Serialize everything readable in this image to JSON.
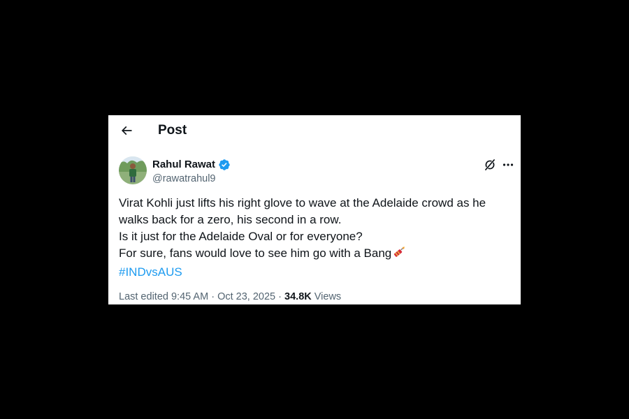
{
  "header": {
    "title": "Post"
  },
  "author": {
    "display_name": "Rahul Rawat",
    "handle": "@rawatrahul9",
    "verified": true
  },
  "tweet": {
    "lines": [
      "Virat Kohli just lifts his right glove to wave at the Adelaide crowd as he",
      "walks back for a zero, his second in a row.",
      "Is it just for the Adelaide Oval or for everyone?",
      "For sure, fans would love to see him go with a Bang"
    ],
    "hashtag": "#INDvsAUS"
  },
  "meta": {
    "edited_label": "Last edited",
    "time": "9:45 AM",
    "separator": "·",
    "date": "Oct 23, 2025",
    "views_count": "34.8K",
    "views_label": "Views"
  },
  "icons": {
    "back": "arrow-left-icon",
    "verified": "verified-badge-icon",
    "grok": "grok-icon",
    "more": "more-horizontal-icon",
    "emoji": "firecracker-emoji"
  },
  "colors": {
    "accent": "#1d9bf0",
    "text_primary": "#0f1419",
    "text_secondary": "#536471",
    "background": "#ffffff",
    "page_background": "#000000"
  }
}
